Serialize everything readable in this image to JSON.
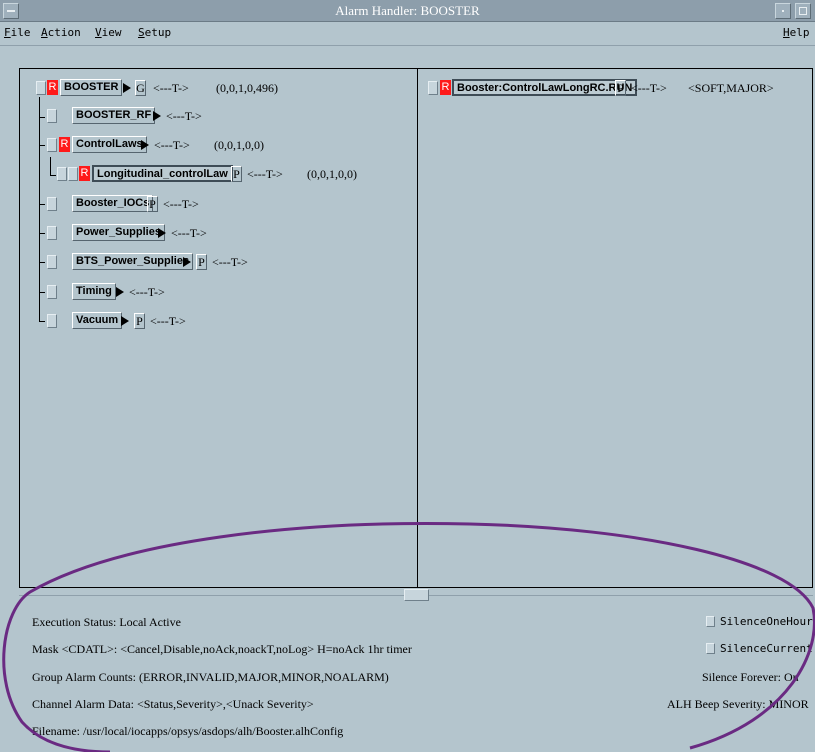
{
  "window": {
    "title": "Alarm Handler: BOOSTER"
  },
  "menubar": {
    "file": {
      "underline": "F",
      "rest": "ile"
    },
    "action": {
      "underline": "A",
      "rest": "ction"
    },
    "view": {
      "underline": "V",
      "rest": "iew"
    },
    "setup": {
      "underline": "S",
      "rest": "etup"
    },
    "help": {
      "underline": "H",
      "rest": "elp"
    }
  },
  "tree": {
    "booster": {
      "flag": "R",
      "name": "BOOSTER",
      "guide": "G",
      "timer": "<---T->",
      "counts": "(0,0,1,0,496)"
    },
    "booster_rf": {
      "name": "BOOSTER_RF",
      "timer": "<---T->"
    },
    "control_laws": {
      "flag": "R",
      "name": "ControlLaws",
      "timer": "<---T->",
      "counts": "(0,0,1,0,0)"
    },
    "longitudinal": {
      "flag": "R",
      "name": "Longitudinal_controlLaw",
      "process": "P",
      "timer": "<---T->",
      "counts": "(0,0,1,0,0)"
    },
    "booster_iocs": {
      "name": "Booster_IOCs",
      "process": "P",
      "timer": "<---T->"
    },
    "power_supplies": {
      "name": "Power_Supplies",
      "timer": "<---T->"
    },
    "bts_power_supplies": {
      "name": "BTS_Power_Supplies",
      "process": "P",
      "timer": "<---T->"
    },
    "timing": {
      "name": "Timing",
      "timer": "<---T->"
    },
    "vacuum": {
      "name": "Vacuum",
      "process": "P",
      "timer": "<---T->"
    }
  },
  "channel": {
    "flag": "R",
    "name": "Booster:ControlLawLongRC.RUN",
    "process": "P",
    "timer": "<---T->",
    "severity": "<SOFT,MAJOR>"
  },
  "status": {
    "execution": "Execution Status:  Local Active",
    "mask": "Mask <CDATL>:  <Cancel,Disable,noAck,noackT,noLog>     H=noAck 1hr timer",
    "group_counts": "Group Alarm Counts:  (ERROR,INVALID,MAJOR,MINOR,NOALARM)",
    "channel_data": "Channel Alarm Data:  <Status,Severity>,<Unack Severity>",
    "filename": "Filename:   /usr/local/iocapps/opsys/asdops/alh/Booster.alhConfig",
    "silence_one_hour": "SilenceOneHour",
    "silence_current": "SilenceCurrent",
    "silence_forever": "Silence Forever:  On",
    "beep_severity": "ALH Beep Severity:  MINOR"
  },
  "colors": {
    "background": "#b4c5cd",
    "alarm_flag": "#ff1a1a",
    "annotation": "#6a2a82"
  }
}
